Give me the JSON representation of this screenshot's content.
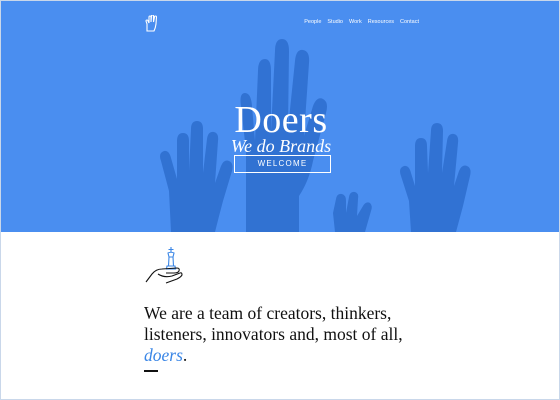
{
  "brand": {
    "logo_icon": "raised-hand-icon",
    "accent": "#3a86e6",
    "hero_bg": "#4a8ef0"
  },
  "nav": {
    "items": [
      "People",
      "Studio",
      "Work",
      "Resources",
      "Contact"
    ]
  },
  "hero": {
    "title": "Doers",
    "subtitle": "We do Brands",
    "cta": "WELCOME"
  },
  "about": {
    "illustration_icon": "hand-holding-chess-king-icon",
    "tagline_lead": "We are a team of creators, thinkers, listeners, innovators and, most of all, ",
    "tagline_accent": "doers",
    "tagline_end": "."
  }
}
